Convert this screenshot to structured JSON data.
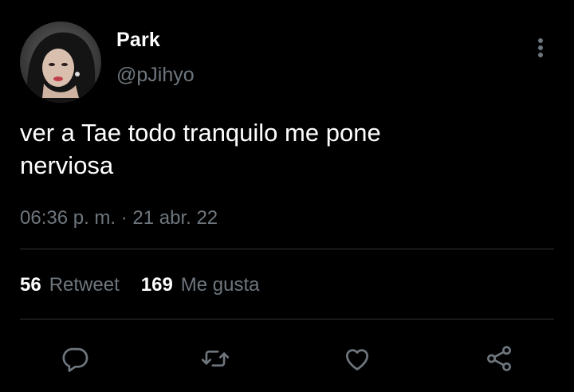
{
  "user": {
    "display_name": "Park",
    "handle": "@pJihyo"
  },
  "tweet": {
    "text": "ver a Tae todo tranquilo me pone\nnerviosa",
    "timestamp": "06:36 p. m. · 21 abr. 22"
  },
  "stats": {
    "retweets_count": "56",
    "retweets_label": "Retweet",
    "likes_count": "169",
    "likes_label": "Me gusta"
  },
  "icons": {
    "reply": "reply-icon",
    "retweet": "retweet-icon",
    "like": "heart-icon",
    "share": "share-icon",
    "more": "more-options-icon"
  },
  "colors": {
    "background": "#000000",
    "text": "#ffffff",
    "secondary": "#6e767d",
    "divider": "#2f3336"
  }
}
